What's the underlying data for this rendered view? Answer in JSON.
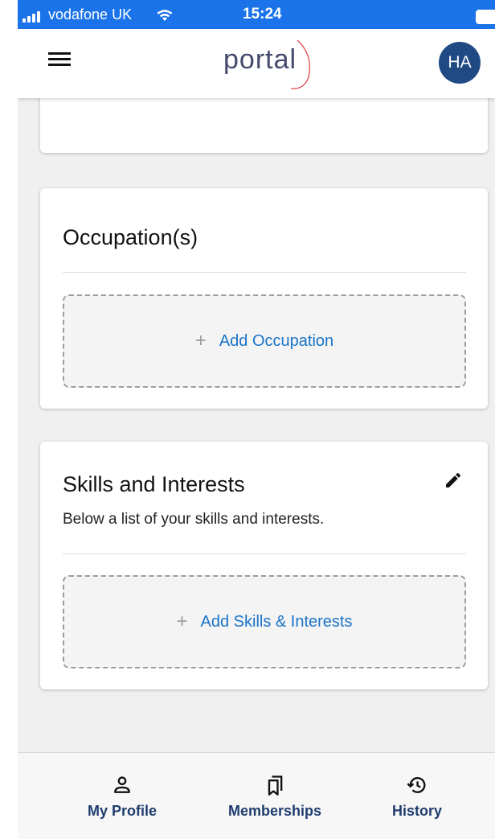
{
  "status_bar": {
    "carrier": "vodafone UK",
    "time": "15:24"
  },
  "app_bar": {
    "logo_text": "portal",
    "avatar_initials": "HA"
  },
  "occupations_card": {
    "title": "Occupation(s)",
    "add_plus": "+",
    "add_label": "Add Occupation"
  },
  "skills_card": {
    "title": "Skills and Interests",
    "subtitle": "Below a list of your skills and interests.",
    "add_plus": "+",
    "add_label": "Add Skills & Interests"
  },
  "bottom_nav": {
    "items": [
      {
        "label": "My Profile",
        "icon": "person-icon"
      },
      {
        "label": "Memberships",
        "icon": "bookmarks-icon"
      },
      {
        "label": "History",
        "icon": "history-icon"
      }
    ]
  },
  "colors": {
    "status_bar": "#1a73e8",
    "avatar": "#1f4a83",
    "link": "#1a73c8",
    "nav_label": "#1f3d6d"
  }
}
